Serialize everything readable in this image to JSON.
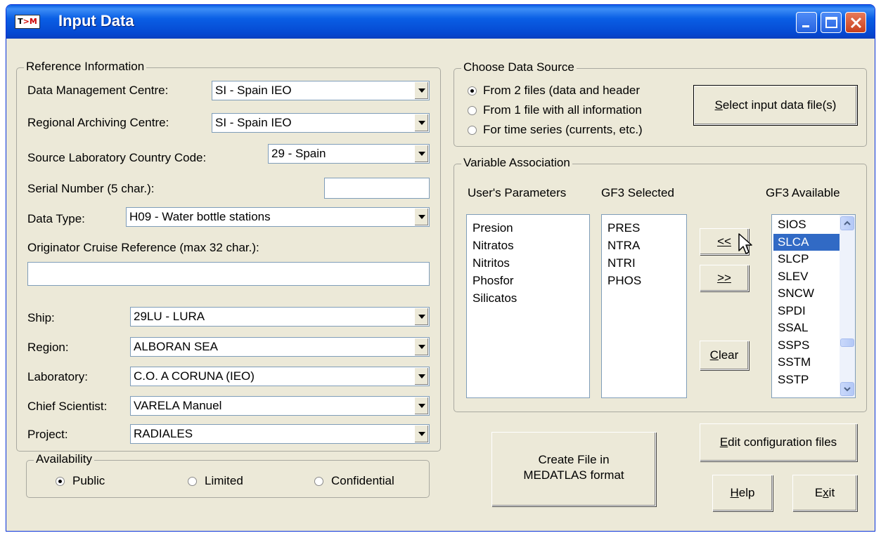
{
  "window": {
    "title": "Input Data",
    "app_icon": "T>M"
  },
  "reference": {
    "group_label": "Reference Information",
    "dmc_label": "Data Management Centre:",
    "dmc_value": "SI - Spain IEO",
    "rac_label": "Regional Archiving Centre:",
    "rac_value": "SI - Spain IEO",
    "country_label": "Source Laboratory Country Code:",
    "country_value": "29 - Spain",
    "serial_label": "Serial Number (5 char.):",
    "serial_value": "",
    "datatype_label": "Data Type:",
    "datatype_value": "H09 - Water bottle stations",
    "cruise_label": "Originator Cruise Reference (max 32 char.):",
    "cruise_value": "",
    "ship_label": "Ship:",
    "ship_value": "29LU - LURA",
    "region_label": "Region:",
    "region_value": "ALBORAN SEA",
    "lab_label": "Laboratory:",
    "lab_value": "C.O. A CORUNA (IEO)",
    "chief_label": "Chief Scientist:",
    "chief_value": "VARELA Manuel",
    "project_label": "Project:",
    "project_value": "RADIALES"
  },
  "availability": {
    "group_label": "Availability",
    "options": [
      "Public",
      "Limited",
      "Confidential"
    ],
    "selected": "Public"
  },
  "data_source": {
    "group_label": "Choose Data Source",
    "options": [
      "From 2 files (data and header",
      "From 1 file with all information",
      "For time series (currents, etc.)"
    ],
    "selected": "From 2 files (data and header",
    "select_button": {
      "mnemonic": "S",
      "rest": "elect input data file(s)"
    }
  },
  "variables": {
    "group_label": "Variable Association",
    "users_header": "User's Parameters",
    "selected_header": "GF3 Selected",
    "available_header": "GF3 Available",
    "users_params": [
      "Presion",
      "Nitratos",
      "Nitritos",
      "Phosfor",
      "Silicatos"
    ],
    "gf3_selected": [
      "PRES",
      "NTRA",
      "NTRI",
      "PHOS"
    ],
    "gf3_available": [
      "SIOS",
      "SLCA",
      "SLCP",
      "SLEV",
      "SNCW",
      "SPDI",
      "SSAL",
      "SSPS",
      "SSTM",
      "SSTP"
    ],
    "gf3_available_selected": "SLCA",
    "add_button": "<<",
    "remove_button": ">>",
    "clear_button": {
      "mnemonic": "C",
      "rest": "lear"
    }
  },
  "actions": {
    "create_line1": "Create File in",
    "create_line2": "MEDATLAS format",
    "edit_config": {
      "mnemonic": "E",
      "rest": "dit configuration files"
    },
    "help": {
      "mnemonic": "H",
      "rest": "elp"
    },
    "exit": {
      "before": "E",
      "mnemonic": "x",
      "rest": "it"
    }
  }
}
